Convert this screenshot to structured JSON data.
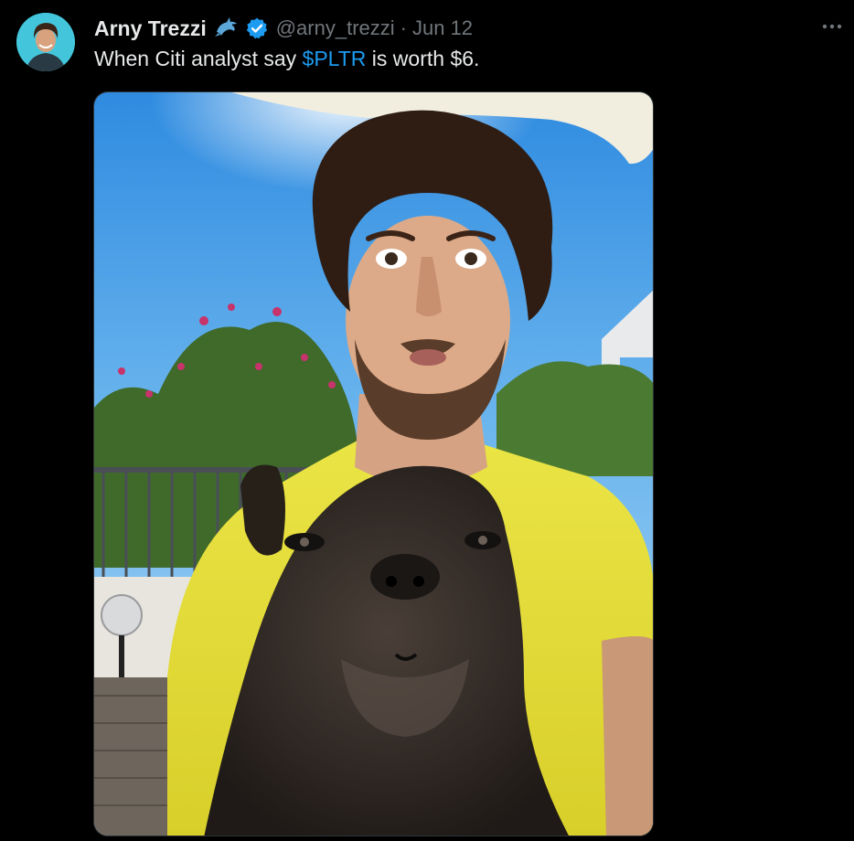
{
  "tweet": {
    "author": {
      "name": "Arny Trezzi",
      "handle": "@arny_trezzi",
      "avatar_icon": "avatar-photo",
      "badge_icon": "dolphin-emoji-icon",
      "verified_icon": "verified-badge-icon",
      "verified_color": "#1d9bf0"
    },
    "separator": "·",
    "date": "Jun 12",
    "more_icon": "ellipsis-icon",
    "text": {
      "before": "When Citi analyst say ",
      "cashtag": "$PLTR",
      "after": " is worth $6."
    },
    "media": {
      "type": "photo",
      "image_icon": "selfie-with-french-bulldog-photo"
    }
  },
  "colors": {
    "background": "#000000",
    "primary_text": "#e7e9ea",
    "secondary_text": "#71767b",
    "link": "#1d9bf0"
  }
}
